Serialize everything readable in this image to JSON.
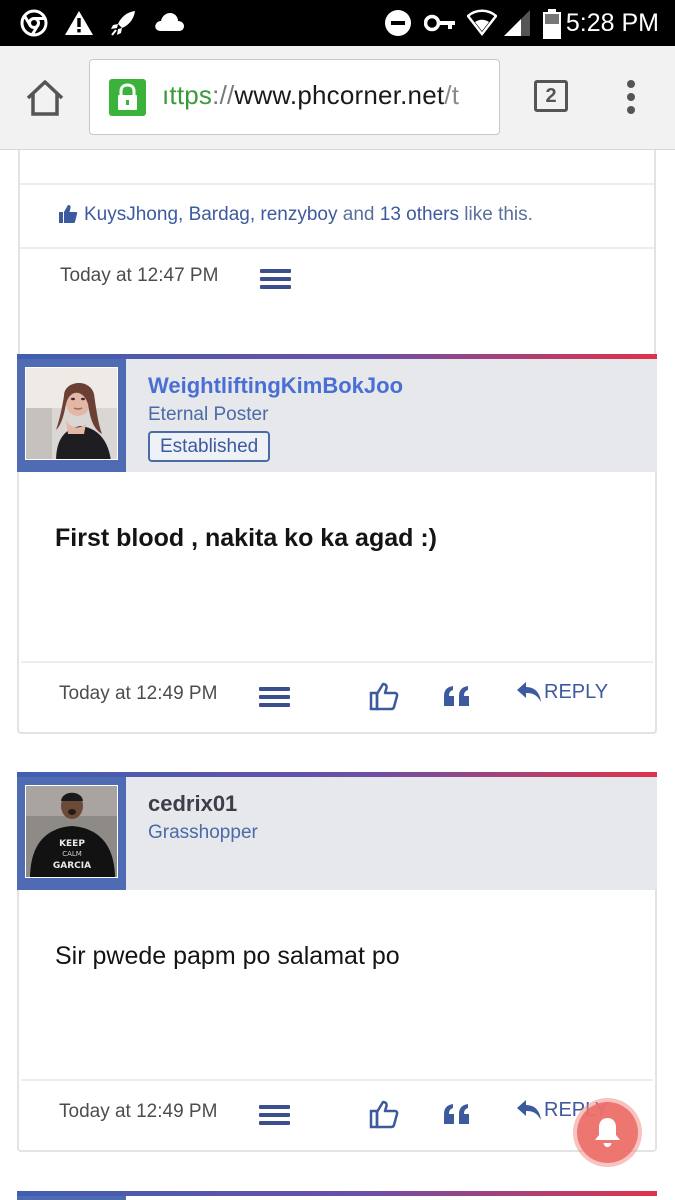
{
  "status_bar": {
    "time": "5:28 PM",
    "icons": [
      "chrome-icon",
      "warning-icon",
      "rocket-icon",
      "cloud-icon",
      "do-not-disturb-icon",
      "key-icon",
      "wifi-icon",
      "signal-icon",
      "battery-icon"
    ]
  },
  "browser": {
    "url_scheme": "ıttps",
    "url_sep": "://",
    "url_host": "www.phcorner.net",
    "url_path": "/t",
    "tab_count": "2"
  },
  "previous_post": {
    "likes": {
      "names": "KuysJhong, Bardag, renzyboy",
      "and1": " and ",
      "others": "13 others",
      "suffix": " like this."
    },
    "time": "Today at 12:47 PM"
  },
  "posts": [
    {
      "username": "WeightliftingKimBokJoo",
      "title": "Eternal Poster",
      "badge": "Established",
      "body": "First blood , nakita ko ka agad :)",
      "time": "Today at 12:49 PM",
      "reply_label": "REPLY"
    },
    {
      "username": "cedrix01",
      "title": "Grasshopper",
      "body": "Sir pwede papm po salamat po",
      "time": "Today at 12:49 PM",
      "reply_label": "REPLY",
      "avatar_shirt_lines": [
        "KEEP",
        "CALM",
        "GARCIA"
      ]
    }
  ],
  "colors": {
    "accent_blue": "#3d5a9e",
    "username_blue": "#4a6fd4",
    "header_bg": "#e6e8ec",
    "gradient_start": "#3f5fb0",
    "gradient_end": "#e0324a",
    "notification_red": "#ee6f6a"
  }
}
